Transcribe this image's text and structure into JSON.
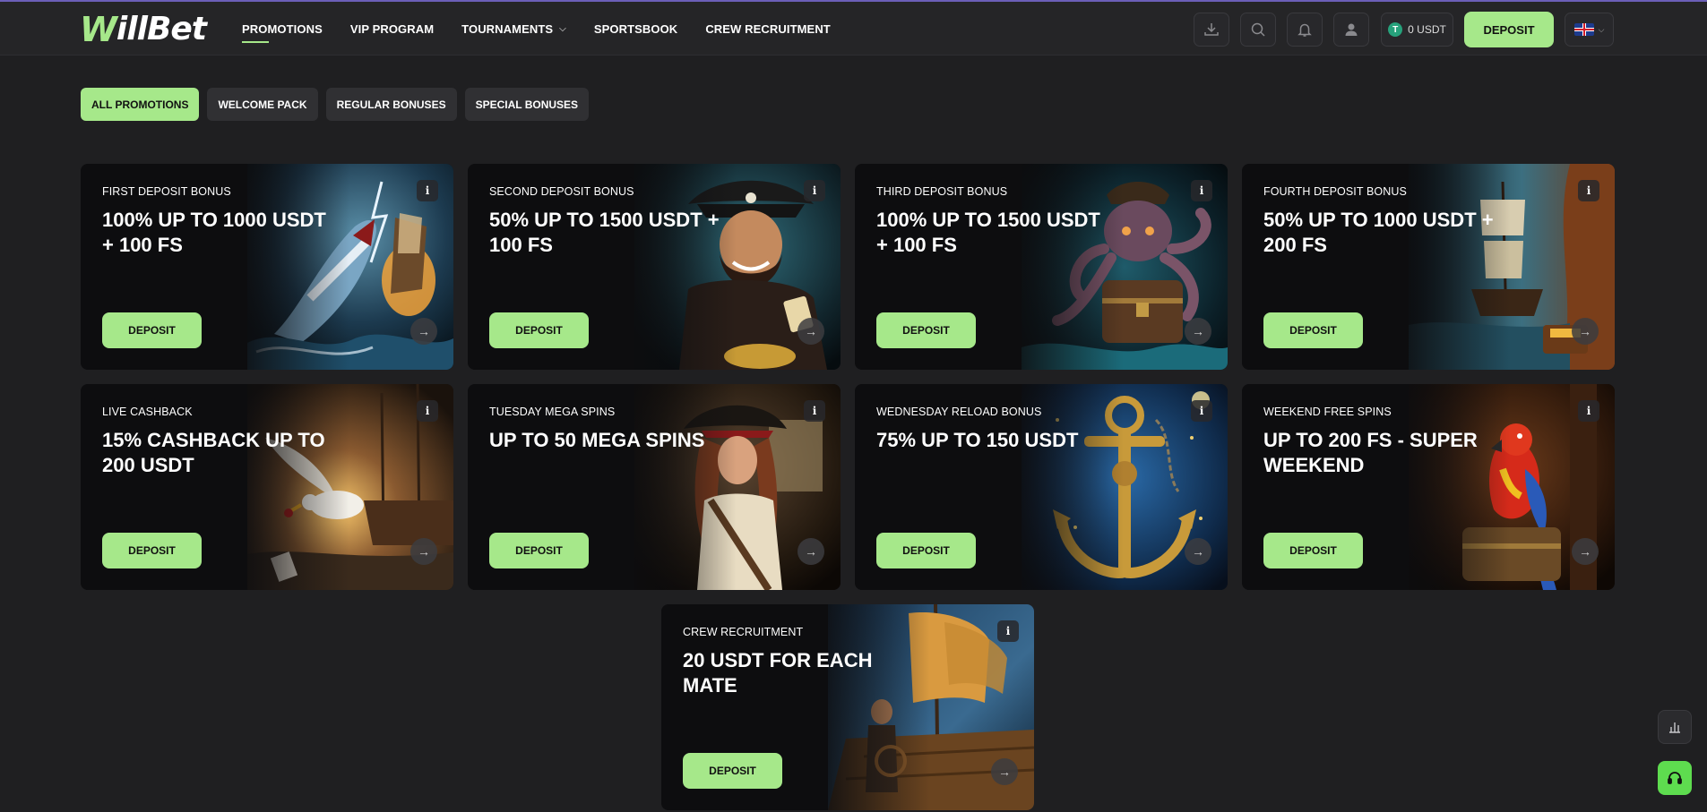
{
  "brand": {
    "logo_first": "W",
    "logo_rest": "illBet"
  },
  "nav": {
    "items": [
      {
        "label": "PROMOTIONS"
      },
      {
        "label": "VIP PROGRAM"
      },
      {
        "label": "TOURNAMENTS"
      },
      {
        "label": "SPORTSBOOK"
      },
      {
        "label": "CREW RECRUITMENT"
      }
    ]
  },
  "header": {
    "balance": "0 USDT",
    "tether_symbol": "T",
    "deposit_label": "DEPOSIT"
  },
  "filters": [
    {
      "label": "ALL PROMOTIONS"
    },
    {
      "label": "WELCOME PACK"
    },
    {
      "label": "REGULAR BONUSES"
    },
    {
      "label": "SPECIAL BONUSES"
    }
  ],
  "cards": [
    {
      "subtitle": "FIRST DEPOSIT BONUS",
      "headline": "100% UP TO 1000 USDT + 100 FS",
      "button": "DEPOSIT",
      "info": "i",
      "arrow": "→"
    },
    {
      "subtitle": "SECOND DEPOSIT BONUS",
      "headline": "50% UP TO 1500 USDT + 100 FS",
      "button": "DEPOSIT",
      "info": "i",
      "arrow": "→"
    },
    {
      "subtitle": "THIRD DEPOSIT BONUS",
      "headline": "100% UP TO 1500 USDT + 100 FS",
      "button": "DEPOSIT",
      "info": "i",
      "arrow": "→"
    },
    {
      "subtitle": "FOURTH DEPOSIT BONUS",
      "headline": "50% UP TO 1000 USDT + 200 FS",
      "button": "DEPOSIT",
      "info": "i",
      "arrow": "→"
    },
    {
      "subtitle": "LIVE CASHBACK",
      "headline": "15% CASHBACK UP TO 200 USDT",
      "button": "DEPOSIT",
      "info": "i",
      "arrow": "→"
    },
    {
      "subtitle": "TUESDAY MEGA SPINS",
      "headline": "UP TO 50 MEGA SPINS",
      "button": "DEPOSIT",
      "info": "i",
      "arrow": "→"
    },
    {
      "subtitle": "WEDNESDAY RELOAD BONUS",
      "headline": "75% UP TO 150 USDT",
      "button": "DEPOSIT",
      "info": "i",
      "arrow": "→"
    },
    {
      "subtitle": "WEEKEND FREE SPINS",
      "headline": "UP TO 200 FS - SUPER WEEKEND",
      "button": "DEPOSIT",
      "info": "i",
      "arrow": "→"
    },
    {
      "subtitle": "CREW RECRUITMENT",
      "headline": "20 USDT FOR EACH MATE",
      "button": "DEPOSIT",
      "info": "i",
      "arrow": "→"
    }
  ],
  "colors": {
    "accent": "#a6e88a",
    "background": "#1f1f21",
    "support": "#5edc4f"
  }
}
